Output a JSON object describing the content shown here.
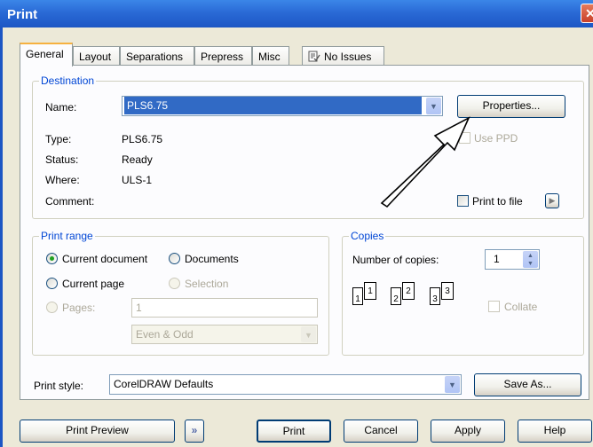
{
  "window": {
    "title": "Print",
    "close_glyph": "✕"
  },
  "tabs": [
    {
      "label": "General"
    },
    {
      "label": "Layout"
    },
    {
      "label": "Separations"
    },
    {
      "label": "Prepress"
    },
    {
      "label": "Misc"
    },
    {
      "label": "No Issues",
      "icon": "issues-icon"
    }
  ],
  "destination": {
    "group_label": "Destination",
    "name_label": "Name:",
    "name_value": "PLS6.75",
    "properties_button": "Properties...",
    "use_ppd_label": "Use PPD",
    "type_label": "Type:",
    "type_value": "PLS6.75",
    "status_label": "Status:",
    "status_value": "Ready",
    "where_label": "Where:",
    "where_value": "ULS-1",
    "comment_label": "Comment:",
    "print_to_file_label": "Print to file",
    "print_to_file_arrow": "▶"
  },
  "print_range": {
    "group_label": "Print range",
    "current_document": "Current document",
    "documents": "Documents",
    "current_page": "Current page",
    "selection": "Selection",
    "pages_label": "Pages:",
    "pages_value": "1",
    "even_odd_value": "Even & Odd"
  },
  "copies": {
    "group_label": "Copies",
    "number_label": "Number of copies:",
    "number_value": "1",
    "collate_label": "Collate",
    "illustration_numbers": [
      "1",
      "1",
      "2",
      "2",
      "3",
      "3"
    ]
  },
  "print_style": {
    "label": "Print style:",
    "value": "CorelDRAW Defaults",
    "save_as_button": "Save As..."
  },
  "footer": {
    "print_preview": "Print Preview",
    "expand_glyph": "»",
    "print": "Print",
    "cancel": "Cancel",
    "apply": "Apply",
    "help": "Help"
  },
  "colors": {
    "title_bar": "#2a6ad6",
    "selection": "#316ac5",
    "group_label": "#0046d5",
    "radio_on": "#21a121"
  }
}
